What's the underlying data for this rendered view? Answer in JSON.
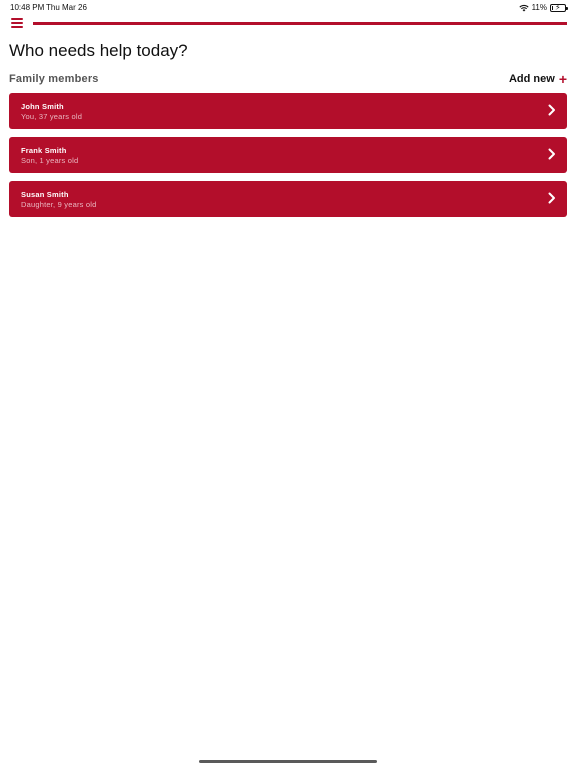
{
  "status": {
    "time": "10:48 PM",
    "date": "Thu Mar 26",
    "battery": "11%",
    "battery_level": 0.11,
    "icons": [
      "wifi-icon",
      "battery-charging-icon"
    ]
  },
  "nav": {
    "menu_icon": "hamburger-menu-icon",
    "progress": 1.0
  },
  "page": {
    "title": "Who needs help today?"
  },
  "family": {
    "section_label": "Family members",
    "add_new_label": "Add new",
    "add_icon": "plus-icon",
    "members": [
      {
        "name": "John Smith",
        "detail": "You, 37 years old"
      },
      {
        "name": "Frank Smith",
        "detail": "Son, 1 years old"
      },
      {
        "name": "Susan Smith",
        "detail": "Daughter, 9 years old"
      }
    ]
  },
  "colors": {
    "accent": "#b30e2b",
    "card_text": "#ffffff",
    "card_subtext": "#e9b7c1"
  }
}
